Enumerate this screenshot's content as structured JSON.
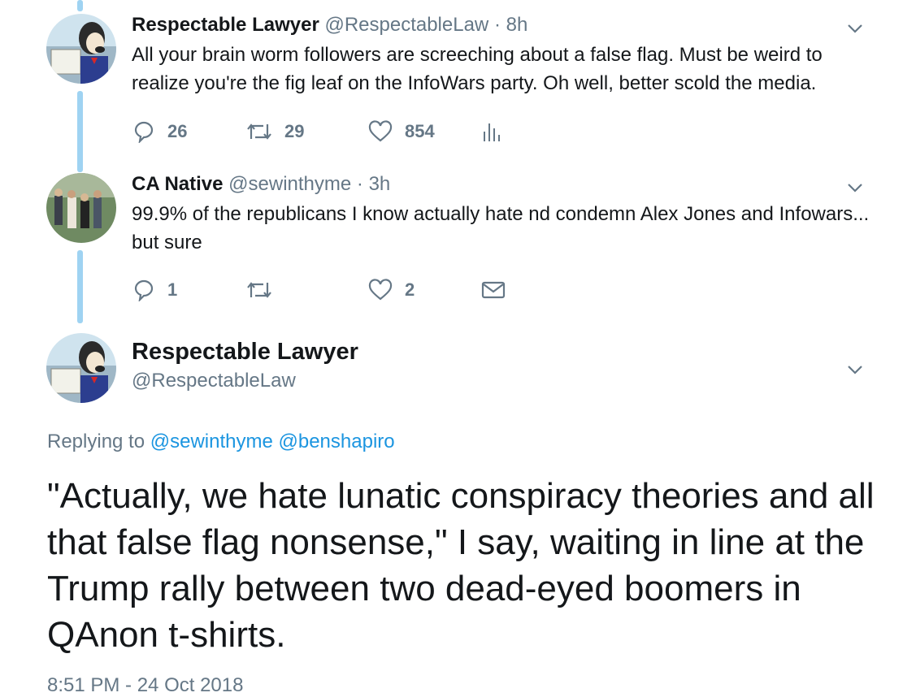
{
  "tweets": [
    {
      "name": "Respectable Lawyer",
      "handle": "@RespectableLaw",
      "sep": "·",
      "time": "8h",
      "text": "All your brain worm followers are screeching about a false flag. Must be weird to realize you're the fig leaf on the InfoWars party. Oh well, better scold the media.",
      "replies": "26",
      "retweets": "29",
      "likes": "854",
      "avatar_icon": "cartoon-dog-lawyer-avatar",
      "extra_action_icon": "analytics-icon"
    },
    {
      "name": "CA Native",
      "handle": "@sewinthyme",
      "sep": "·",
      "time": "3h",
      "text": "99.9% of the republicans I know actually hate nd condemn Alex Jones and Infowars... but sure",
      "replies": "1",
      "retweets": "",
      "likes": "2",
      "avatar_icon": "group-photo-avatar",
      "extra_action_icon": "direct-message-icon"
    }
  ],
  "focused": {
    "name": "Respectable Lawyer",
    "handle": "@RespectableLaw",
    "replying_label": "Replying to",
    "replying_to": [
      "@sewinthyme",
      "@benshapiro"
    ],
    "text": "\"Actually, we hate lunatic conspiracy theories and all that false flag nonsense,\" I say, waiting in line at the Trump rally between two dead-eyed boomers in QAnon t-shirts.",
    "timestamp": "8:51 PM - 24 Oct 2018"
  },
  "colors": {
    "thread_line": "#9fd3f2",
    "secondary_text": "#657786",
    "link": "#1b95e0"
  }
}
